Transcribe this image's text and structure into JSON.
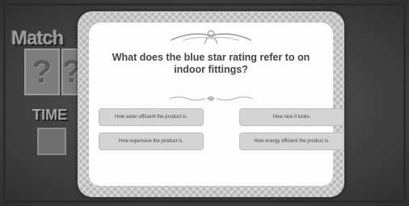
{
  "game": {
    "title": "Match",
    "tile_symbol": "?",
    "time_label": "TIME"
  },
  "quiz": {
    "question": "What does the blue star rating refer to on indoor fittings?",
    "answers": [
      "How water efficient the product is.",
      "How nice it looks.",
      "How expensive the product is.",
      "How energy efficient the product is."
    ]
  },
  "colors": {
    "modal_border": "#b8b8b8",
    "modal_bg": "#fdfdfd",
    "answer_bg": "#d4d4d4",
    "question_text": "#444444"
  },
  "icons": [
    "ribbon-ornament-icon",
    "flourish-divider-icon"
  ]
}
